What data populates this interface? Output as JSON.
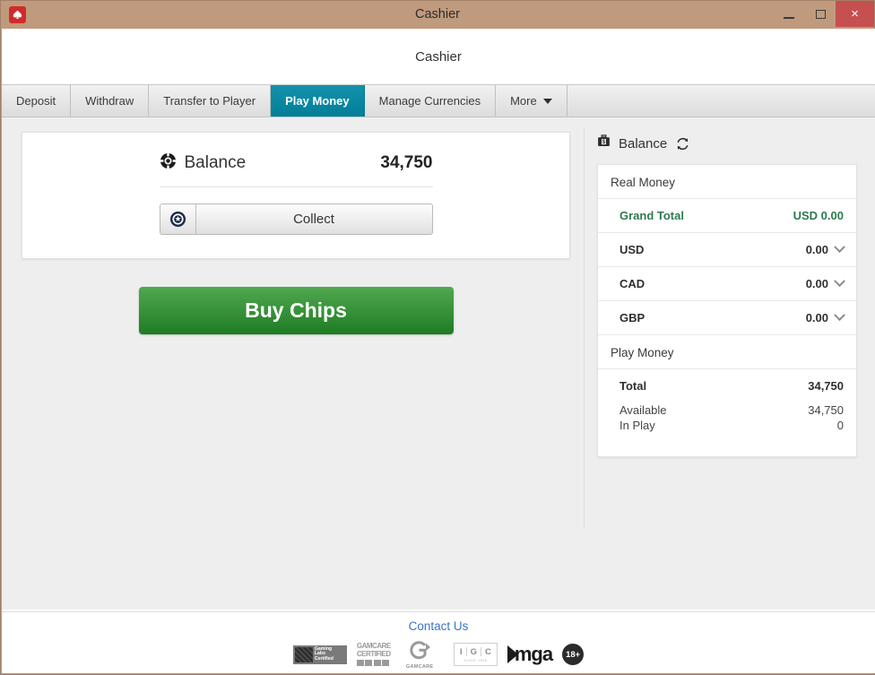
{
  "window": {
    "title": "Cashier",
    "app_icon": "spade-icon",
    "controls": {
      "minimize": "minimize-icon",
      "maximize": "maximize-icon",
      "close": "×"
    }
  },
  "header": {
    "title": "Cashier"
  },
  "tabs": [
    {
      "label": "Deposit",
      "active": false
    },
    {
      "label": "Withdraw",
      "active": false
    },
    {
      "label": "Transfer to Player",
      "active": false
    },
    {
      "label": "Play Money",
      "active": true
    },
    {
      "label": "Manage Currencies",
      "active": false
    },
    {
      "label": "More",
      "active": false,
      "has_caret": true
    }
  ],
  "main": {
    "balance_card": {
      "icon": "poker-chip-icon",
      "label": "Balance",
      "amount": "34,750",
      "collect_button": {
        "icon": "poker-chip-icon",
        "label": "Collect"
      }
    },
    "buy_chips_label": "Buy Chips"
  },
  "balance_panel": {
    "icon": "money-bag-icon",
    "title": "Balance",
    "refresh_icon": "refresh-icon",
    "sections": [
      {
        "title": "Real Money",
        "rows": [
          {
            "key": "Grand Total",
            "value": "USD 0.00",
            "style": "grand",
            "chevron": false
          },
          {
            "key": "USD",
            "value": "0.00",
            "style": "bold",
            "chevron": true
          },
          {
            "key": "CAD",
            "value": "0.00",
            "style": "bold",
            "chevron": true
          },
          {
            "key": "GBP",
            "value": "0.00",
            "style": "bold",
            "chevron": true
          }
        ]
      },
      {
        "title": "Play Money",
        "rows": [
          {
            "key": "Total",
            "value": "34,750",
            "style": "bold",
            "chevron": false
          }
        ],
        "sub_rows": [
          {
            "key": "Available",
            "value": "34,750"
          },
          {
            "key": "In Play",
            "value": "0"
          }
        ]
      }
    ]
  },
  "footer": {
    "contact_us": "Contact Us",
    "logos": [
      {
        "name": "gaming-labs-certified-logo",
        "line1": "Gaming",
        "line2": "Labs",
        "line3": "Certified"
      },
      {
        "name": "gamcare-certified-logo",
        "line1": "GAMCARE",
        "line2": "CERTIFIED"
      },
      {
        "name": "gamcare-logo",
        "caption": "GAMCARE"
      },
      {
        "name": "igc-logo",
        "letters": [
          "I",
          "G",
          "C"
        ],
        "since": "SINCE 1996"
      },
      {
        "name": "mga-logo",
        "text": "mga"
      },
      {
        "name": "age-18-plus-logo",
        "text": "18+"
      }
    ]
  },
  "colors": {
    "titlebar": "#c09a7d",
    "active_tab": "#007e98",
    "buy_chips": "#1f7c24",
    "grand_total": "#2d7a4f",
    "link": "#3b73c4",
    "close_button": "#c5504f"
  }
}
